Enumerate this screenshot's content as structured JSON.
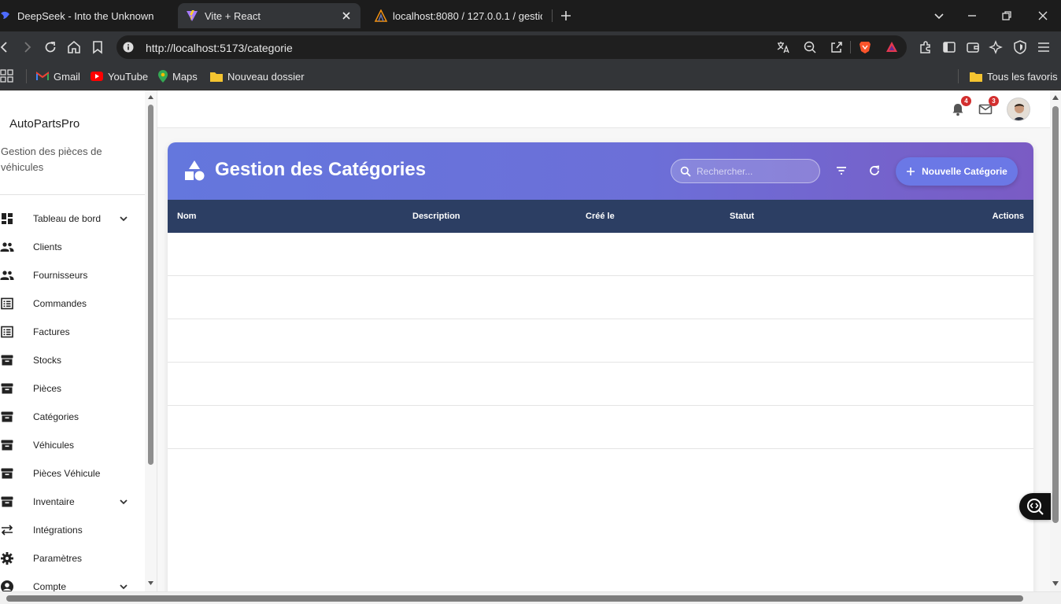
{
  "browser": {
    "tabs": [
      {
        "title": "DeepSeek - Into the Unknown",
        "active": false
      },
      {
        "title": "Vite + React",
        "active": true
      },
      {
        "title": "localhost:8080 / 127.0.0.1 / gestion_",
        "active": false
      }
    ],
    "url": "http://localhost:5173/categorie",
    "bookmarks": [
      "Gmail",
      "YouTube",
      "Maps",
      "Nouveau dossier"
    ],
    "bookmarks_all": "Tous les favoris"
  },
  "sidebar": {
    "brand": "AutoPartsPro",
    "subtitle": "Gestion des pièces de véhicules",
    "items": [
      {
        "label": "Tableau de bord",
        "icon": "dashboard-icon",
        "expandable": true
      },
      {
        "label": "Clients",
        "icon": "people-icon",
        "expandable": false
      },
      {
        "label": "Fournisseurs",
        "icon": "people-icon",
        "expandable": false
      },
      {
        "label": "Commandes",
        "icon": "list-icon",
        "expandable": false
      },
      {
        "label": "Factures",
        "icon": "list-icon",
        "expandable": false
      },
      {
        "label": "Stocks",
        "icon": "archive-icon",
        "expandable": false
      },
      {
        "label": "Pièces",
        "icon": "archive-icon",
        "expandable": false
      },
      {
        "label": "Catégories",
        "icon": "archive-icon",
        "expandable": false
      },
      {
        "label": "Véhicules",
        "icon": "archive-icon",
        "expandable": false
      },
      {
        "label": "Pièces Véhicule",
        "icon": "archive-icon",
        "expandable": false
      },
      {
        "label": "Inventaire",
        "icon": "archive-icon",
        "expandable": true
      },
      {
        "label": "Intégrations",
        "icon": "swap-icon",
        "expandable": false
      },
      {
        "label": "Paramètres",
        "icon": "gear-icon",
        "expandable": false
      },
      {
        "label": "Compte",
        "icon": "account-icon",
        "expandable": true
      }
    ]
  },
  "topbar": {
    "notifications_count": "4",
    "messages_count": "3"
  },
  "page": {
    "title": "Gestion des Catégories",
    "search_placeholder": "Rechercher...",
    "new_button": "Nouvelle Catégorie",
    "columns": [
      "Nom",
      "Description",
      "Créé le",
      "Statut",
      "Actions"
    ],
    "rows": [
      {},
      {},
      {},
      {},
      {}
    ]
  },
  "colors": {
    "header_gradient_start": "#6477dd",
    "header_gradient_end": "#7a5bc4",
    "table_header": "#2c3e63",
    "badge": "#d32f2f"
  }
}
